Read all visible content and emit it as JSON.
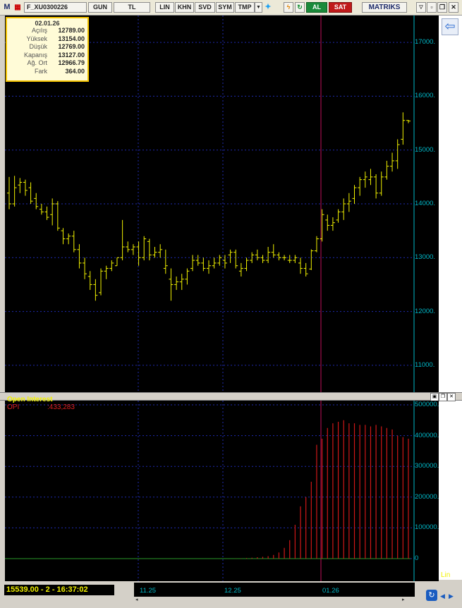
{
  "toolbar": {
    "m_label": "M",
    "symbol": "F_XU0300226",
    "period": "GUN",
    "currency": "TL",
    "scale": "LIN",
    "khn": "KHN",
    "svd": "SVD",
    "sym": "SYM",
    "tmp": "TMP",
    "buy": "AL",
    "sell": "SAT",
    "brand": "MATRIKS"
  },
  "info": {
    "date": "02.01.26",
    "rows": [
      {
        "label": "Açılış",
        "value": "12789.00"
      },
      {
        "label": "Yüksek",
        "value": "13154.00"
      },
      {
        "label": "Düşük",
        "value": "12769.00"
      },
      {
        "label": "Kapanış",
        "value": "13127.00"
      },
      {
        "label": "Ağ. Ort",
        "value": "12966.79"
      },
      {
        "label": "Fark",
        "value": "364.00"
      }
    ]
  },
  "price_axis": [
    "17000.",
    "16000.",
    "15000.",
    "14000.",
    "13000.",
    "12000.",
    "11000."
  ],
  "oi_panel": {
    "title": "Open Interest",
    "series_label": "OPI",
    "series_value": ":433,283",
    "axis": [
      "500000.",
      "400000.",
      "300000.",
      "200000.",
      "100000.",
      "0"
    ],
    "scale": "Lin"
  },
  "status": "15539.00 - 2 - 16:37:02",
  "dates": [
    "11.25",
    "12.25",
    "01.26"
  ],
  "colors": {
    "price": "#f2f200",
    "oi": "#d01818",
    "grid": "#1f2bb0",
    "axis": "#00b8c8",
    "cursor": "#c0105a"
  },
  "chart_data": {
    "type": "bar",
    "title": "",
    "price_bars": [
      [
        14200,
        14500,
        13900,
        14000
      ],
      [
        14000,
        14520,
        13950,
        14300
      ],
      [
        14350,
        14480,
        14200,
        14400
      ],
      [
        14400,
        14450,
        14150,
        14250
      ],
      [
        14300,
        14400,
        14000,
        14050
      ],
      [
        14100,
        14200,
        13900,
        13950
      ],
      [
        13900,
        14000,
        13800,
        13850
      ],
      [
        13850,
        13950,
        13700,
        13750
      ],
      [
        13800,
        14100,
        13600,
        14000
      ],
      [
        14000,
        14050,
        13500,
        13550
      ],
      [
        13500,
        13550,
        13250,
        13350
      ],
      [
        13350,
        13450,
        13250,
        13400
      ],
      [
        13400,
        13500,
        13100,
        13150
      ],
      [
        13150,
        13250,
        12800,
        12900
      ],
      [
        12900,
        13000,
        12600,
        12700
      ],
      [
        12650,
        12750,
        12400,
        12500
      ],
      [
        12500,
        12600,
        12200,
        12300
      ],
      [
        12350,
        12800,
        12300,
        12750
      ],
      [
        12750,
        12850,
        12600,
        12800
      ],
      [
        12800,
        12950,
        12750,
        12900
      ],
      [
        12850,
        13000,
        12850,
        13000
      ],
      [
        13000,
        13700,
        12950,
        13200
      ],
      [
        13200,
        13300,
        13100,
        13150
      ],
      [
        13150,
        13250,
        13050,
        13200
      ],
      [
        13200,
        13300,
        12850,
        13000
      ],
      [
        13000,
        13400,
        12950,
        13350
      ],
      [
        13300,
        13350,
        12950,
        13050
      ],
      [
        13050,
        13200,
        13000,
        13100
      ],
      [
        13100,
        13250,
        13000,
        13150
      ],
      [
        12800,
        13150,
        12700,
        12850
      ],
      [
        12600,
        12800,
        12200,
        12500
      ],
      [
        12500,
        12650,
        12400,
        12550
      ],
      [
        12550,
        12700,
        12400,
        12600
      ],
      [
        12600,
        12800,
        12500,
        12750
      ],
      [
        12800,
        13050,
        12750,
        12950
      ],
      [
        12950,
        13050,
        12850,
        12900
      ],
      [
        12900,
        13000,
        12750,
        12800
      ],
      [
        12800,
        12950,
        12700,
        12850
      ],
      [
        12850,
        13000,
        12800,
        12900
      ],
      [
        12900,
        13050,
        12850,
        13000
      ],
      [
        12950,
        13050,
        12800,
        12900
      ],
      [
        13050,
        13150,
        12900,
        13100
      ],
      [
        13100,
        13150,
        12800,
        12850
      ],
      [
        12750,
        12900,
        12650,
        12800
      ],
      [
        12800,
        13000,
        12750,
        12950
      ],
      [
        12950,
        13100,
        12900,
        13050
      ],
      [
        13050,
        13150,
        12950,
        13000
      ],
      [
        13000,
        13050,
        12900,
        12950
      ],
      [
        12950,
        13200,
        12900,
        13100
      ],
      [
        13100,
        13250,
        13000,
        13050
      ],
      [
        13050,
        13100,
        12950,
        13000
      ],
      [
        13000,
        13050,
        12950,
        13000
      ],
      [
        12950,
        13050,
        12900,
        12950
      ],
      [
        12950,
        13050,
        12900,
        13000
      ],
      [
        12900,
        13000,
        12700,
        12800
      ],
      [
        12800,
        12900,
        12650,
        12700
      ],
      [
        12789,
        13154,
        12769,
        13127
      ],
      [
        13127,
        13400,
        13100,
        13350
      ],
      [
        13350,
        13900,
        13300,
        13800
      ],
      [
        13700,
        13800,
        13500,
        13600
      ],
      [
        13600,
        13750,
        13500,
        13650
      ],
      [
        13700,
        13900,
        13650,
        13850
      ],
      [
        13850,
        14100,
        13700,
        14000
      ],
      [
        14000,
        14200,
        13850,
        14050
      ],
      [
        14100,
        14350,
        14000,
        14300
      ],
      [
        14300,
        14500,
        14150,
        14450
      ],
      [
        14450,
        14600,
        14300,
        14500
      ],
      [
        14450,
        14650,
        14350,
        14500
      ],
      [
        14500,
        14550,
        14100,
        14200
      ],
      [
        14200,
        14600,
        14150,
        14500
      ],
      [
        14500,
        14800,
        14450,
        14700
      ],
      [
        14700,
        14950,
        14600,
        14800
      ],
      [
        14800,
        15200,
        14650,
        15100
      ],
      [
        15200,
        15700,
        15100,
        15550
      ],
      [
        15550,
        15560,
        15500,
        15539
      ]
    ],
    "open_interest": [
      0,
      0,
      0,
      0,
      0,
      0,
      0,
      0,
      0,
      0,
      0,
      0,
      0,
      0,
      0,
      0,
      0,
      0,
      0,
      0,
      0,
      0,
      0,
      0,
      0,
      0,
      0,
      0,
      0,
      0,
      0,
      0,
      0,
      0,
      0,
      0,
      0,
      0,
      0,
      0,
      0,
      0,
      500,
      1000,
      2000,
      3000,
      4500,
      6000,
      8000,
      12000,
      20000,
      35000,
      60000,
      110000,
      170000,
      200000,
      250000,
      370000,
      390000,
      425000,
      440000,
      445000,
      450000,
      440000,
      440000,
      435000,
      435000,
      430000,
      435000,
      430000,
      425000,
      420000,
      400000,
      395000,
      390000
    ],
    "ylim_price": [
      10500,
      17500
    ],
    "ylim_oi": [
      0,
      500000
    ],
    "grid": true
  }
}
